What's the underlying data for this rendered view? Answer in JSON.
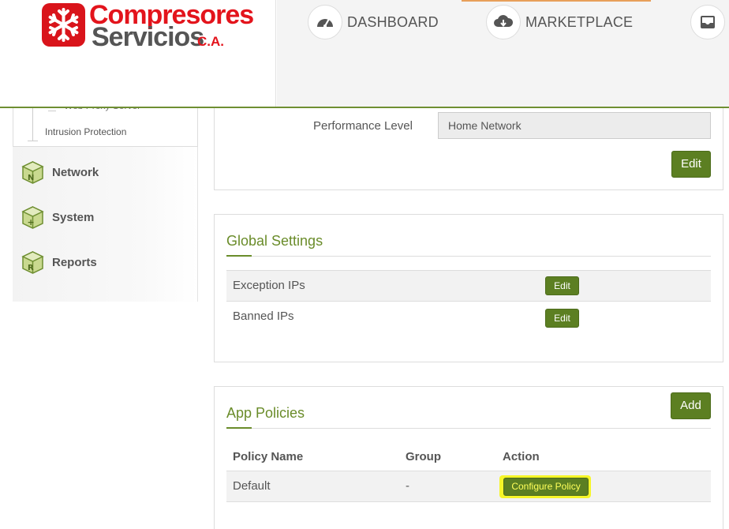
{
  "header": {
    "logo": {
      "line1": "Compresores",
      "line2": "Servicios",
      "suffix": "C.A."
    },
    "nav": [
      {
        "label": "DASHBOARD",
        "icon": "gauge-icon"
      },
      {
        "label": "MARKETPLACE",
        "icon": "cloud-download-icon"
      },
      {
        "label": "",
        "icon": "inbox-icon"
      }
    ]
  },
  "sidebar": {
    "tree_items": [
      "Web Proxy Server",
      "Intrusion Protection"
    ],
    "items": [
      {
        "label": "Network",
        "icon_letter": "N",
        "icon": "network-cube-icon"
      },
      {
        "label": "System",
        "icon_letter": "+",
        "icon": "system-cube-icon"
      },
      {
        "label": "Reports",
        "icon_letter": "R",
        "icon": "reports-cube-icon"
      }
    ]
  },
  "performance": {
    "label": "Performance Level",
    "value": "Home Network",
    "edit_label": "Edit"
  },
  "global_settings": {
    "title": "Global Settings",
    "rows": [
      {
        "label": "Exception IPs",
        "action": "Edit"
      },
      {
        "label": "Banned IPs",
        "action": "Edit"
      }
    ]
  },
  "app_policies": {
    "title": "App Policies",
    "add_label": "Add",
    "columns": [
      "Policy Name",
      "Group",
      "Action"
    ],
    "rows": [
      {
        "name": "Default",
        "group": "-",
        "action": "Configure Policy"
      }
    ]
  },
  "colors": {
    "accent_green": "#5c7f22",
    "title_green": "#6a8c2a",
    "brand_red": "#e3141c",
    "highlight_yellow": "#f6f628"
  }
}
